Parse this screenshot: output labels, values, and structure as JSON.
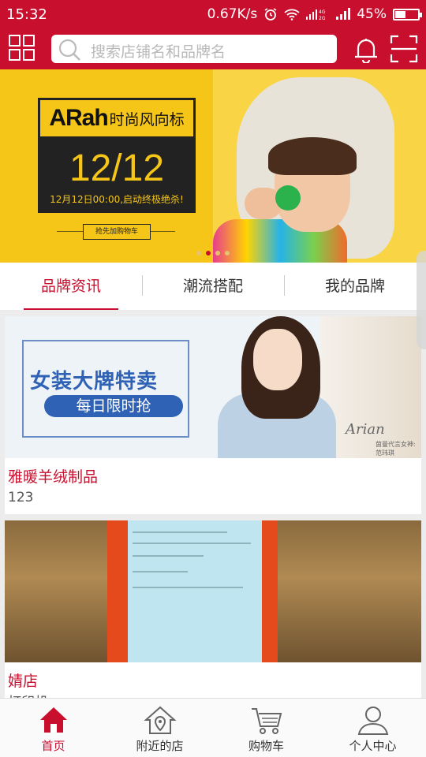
{
  "status_bar": {
    "time": "15:32",
    "net_speed": "0.67K/s",
    "battery_text": "45%",
    "battery_level": 0.45
  },
  "header": {
    "search_placeholder": "搜索店铺名和品牌名",
    "icons": [
      "grid-menu-icon",
      "search-icon",
      "bell-icon",
      "scan-icon"
    ]
  },
  "banner": {
    "brand": "ARah",
    "tagline": "时尚风向标",
    "date": "12/12",
    "subtitle": "12月12日00:00,启动终极绝杀!",
    "button_label": "抢先加购物车",
    "dots_count": 4,
    "active_dot": 1
  },
  "tabs": [
    {
      "label": "品牌资讯",
      "active": true
    },
    {
      "label": "潮流搭配",
      "active": false
    },
    {
      "label": "我的品牌",
      "active": false
    }
  ],
  "cards": [
    {
      "title": "雅暖羊绒制品",
      "subtitle": "123",
      "image": {
        "headline": "女装大牌特卖",
        "pill": "每日限时抢",
        "signature": "Arian",
        "caption": "茵曼代言女神:范玮琪"
      }
    },
    {
      "title": "婧店",
      "subtitle": "打印机"
    }
  ],
  "bottom_nav": [
    {
      "label": "首页",
      "icon": "home-icon",
      "active": true
    },
    {
      "label": "附近的店",
      "icon": "nearby-location-icon",
      "active": false
    },
    {
      "label": "购物车",
      "icon": "cart-icon",
      "active": false
    },
    {
      "label": "个人中心",
      "icon": "user-icon",
      "active": false
    }
  ],
  "colors": {
    "primary": "#c8102e",
    "banner_yellow": "#f5c518",
    "ad_blue": "#2f62b5"
  }
}
